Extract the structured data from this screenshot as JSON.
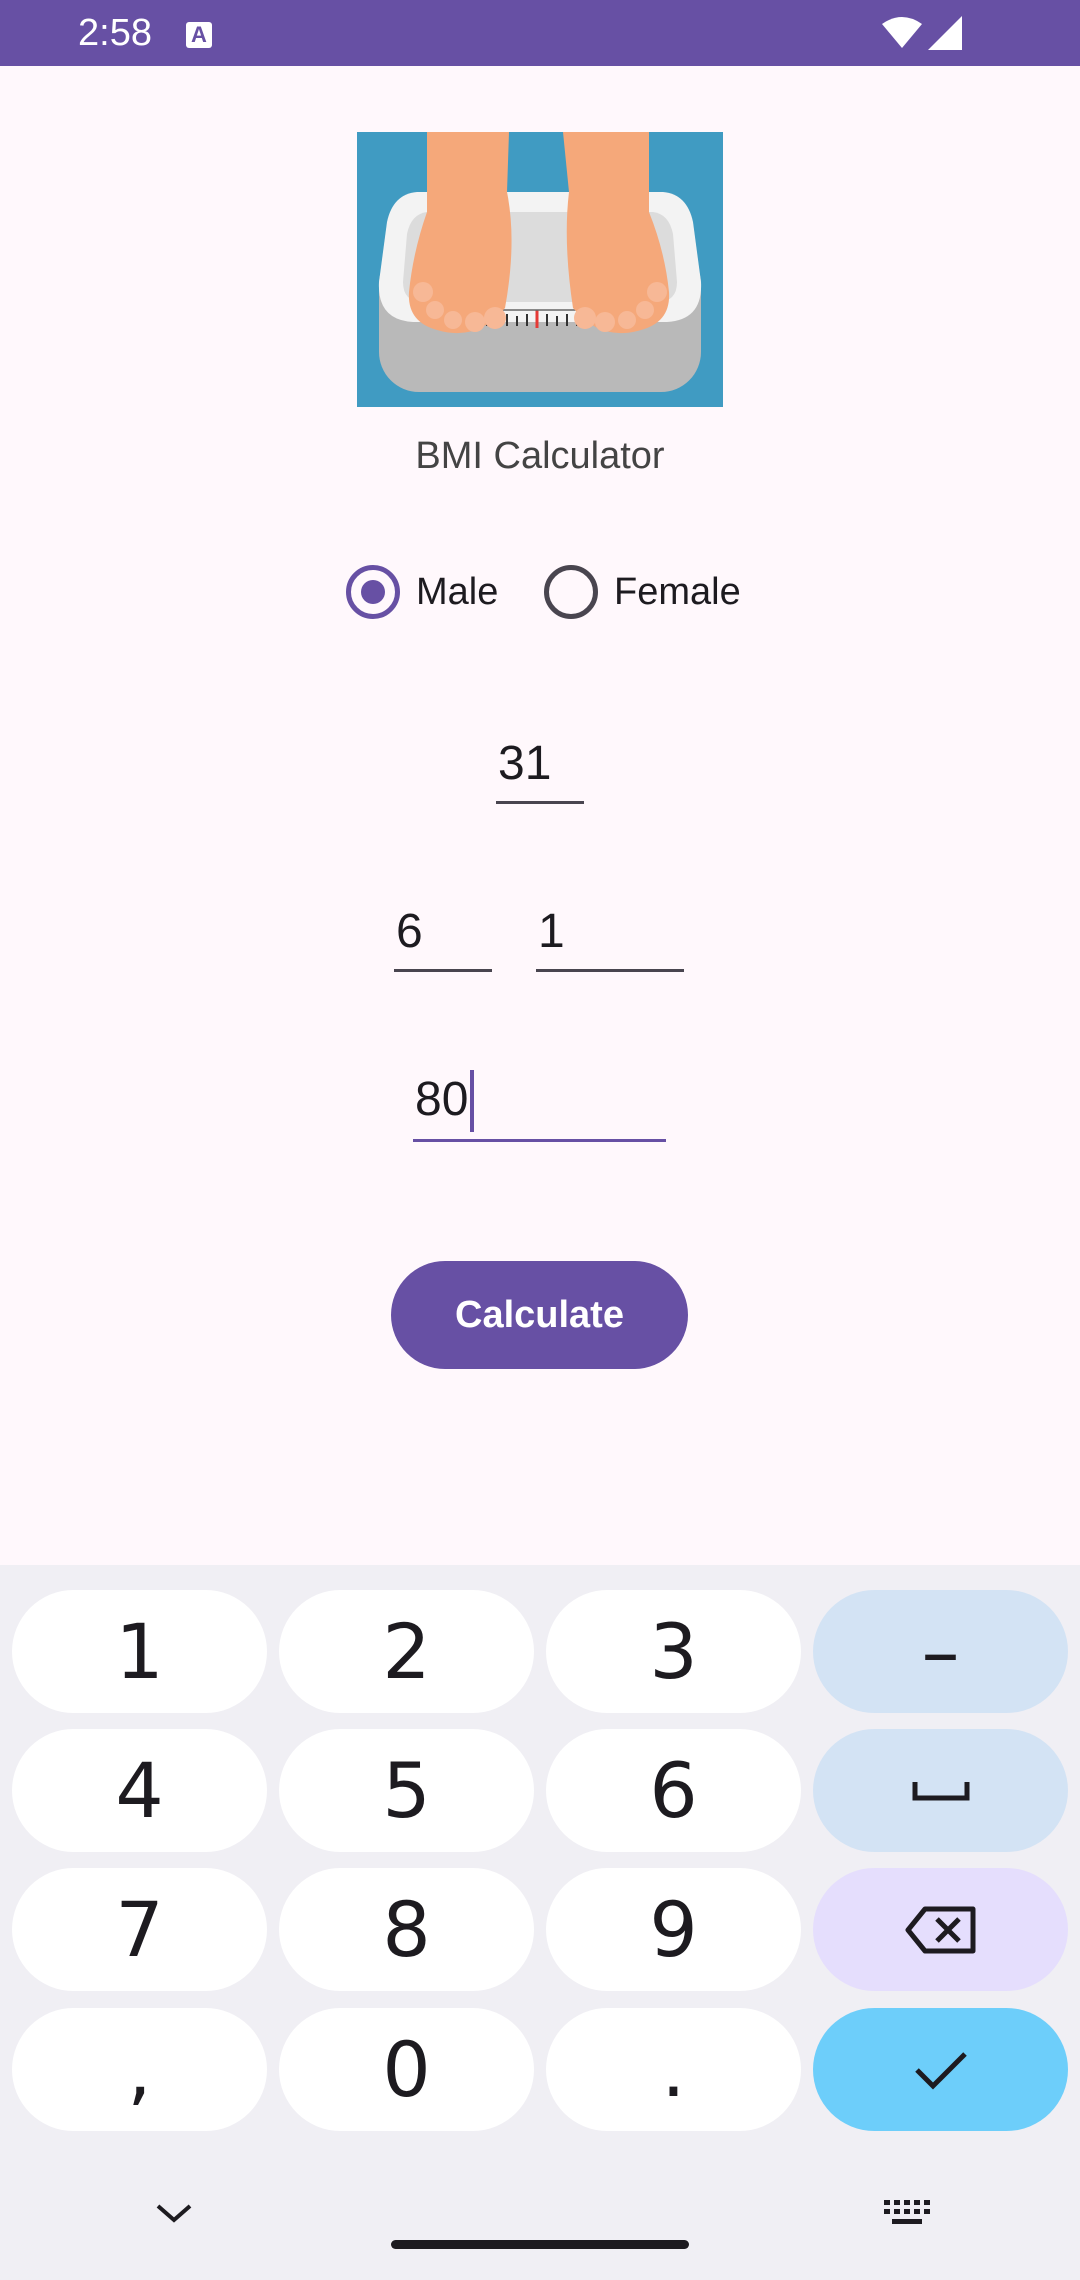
{
  "status_bar": {
    "time": "2:58",
    "notification_icon": "A",
    "icons": [
      "wifi-icon",
      "cellular-signal-icon"
    ],
    "background": "#6750a4"
  },
  "app": {
    "header_image": "bathroom-scale-feet-illustration",
    "title": "BMI Calculator"
  },
  "gender": {
    "options": [
      {
        "label": "Male",
        "checked": true
      },
      {
        "label": "Female",
        "checked": false
      }
    ]
  },
  "inputs": {
    "age": "31",
    "height_feet": "6",
    "height_inches": "1",
    "weight": "80"
  },
  "actions": {
    "calculate_label": "Calculate"
  },
  "keyboard": {
    "rows": [
      [
        "1",
        "2",
        "3",
        "–"
      ],
      [
        "4",
        "5",
        "6",
        "space"
      ],
      [
        "7",
        "8",
        "9",
        "backspace"
      ],
      [
        ",",
        "0",
        ".",
        "done"
      ]
    ],
    "labels": {
      "k1": "1",
      "k2": "2",
      "k3": "3",
      "kdash": "–",
      "k4": "4",
      "k5": "5",
      "k6": "6",
      "k7": "7",
      "k8": "8",
      "k9": "9",
      "kcomma": ",",
      "k0": "0",
      "kdot": "."
    }
  },
  "nav": {
    "left_icon": "chevron-down-icon",
    "right_icon": "keyboard-icon"
  },
  "colors": {
    "primary": "#6750a4",
    "key_function_blue": "#d3e3f4",
    "key_backspace": "#e5defd",
    "key_done": "#6dcefa",
    "background": "#fff8fc"
  }
}
